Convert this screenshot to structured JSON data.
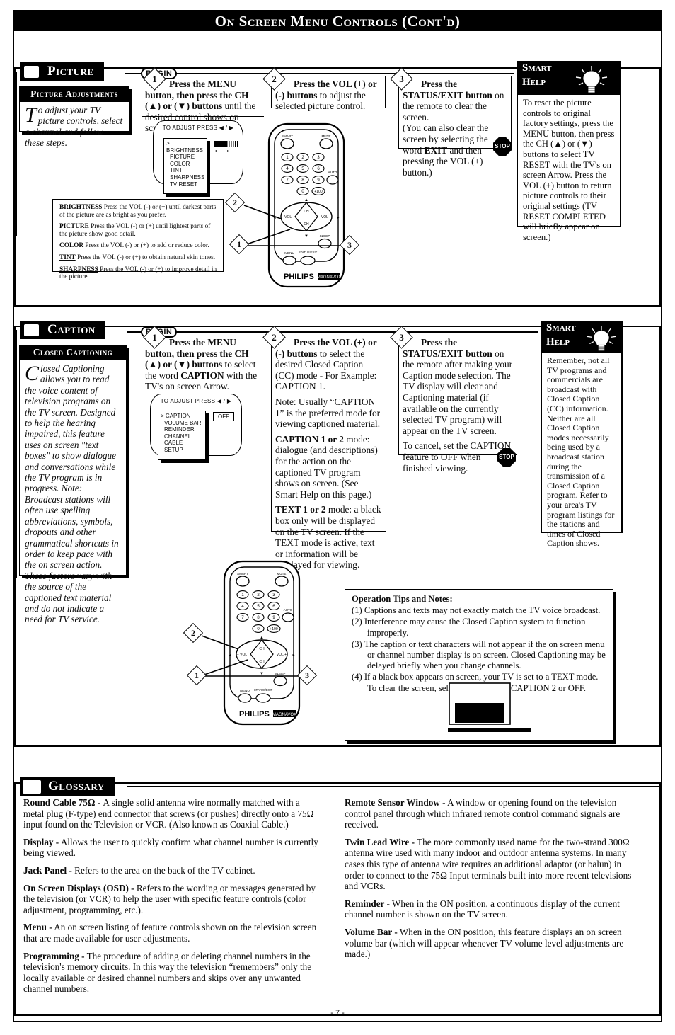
{
  "page": {
    "title": "On Screen Menu Controls (Cont'd)",
    "page_number": "- 7 -"
  },
  "picture_section": {
    "header_label": "Picture",
    "begin_tag": "BEGIN",
    "callout": {
      "title": "Picture Adjustments",
      "dropcap": "T",
      "body": "o adjust your TV picture controls, select a channel and follow these steps."
    },
    "steps": [
      {
        "number": "1",
        "text_html": "<b>Press the MENU button, then press the CH (▲) or (▼) buttons</b> until the desired control shows on screen."
      },
      {
        "number": "2",
        "text_html": "<b>Press the VOL (+) or (-) buttons</b> to adjust the selected picture control."
      },
      {
        "number": "3",
        "text_html": "<b>Press the STATUS/EXIT button</b> on the remote to clear the screen.<br>(You can also clear the screen by selecting the word <b>EXIT</b> and then pressing the VOL (+) button.)"
      }
    ],
    "tv_menu": {
      "header": "TO ADJUST PRESS ◀ / ▶",
      "items": [
        "> BRIGHTNESS",
        "PICTURE",
        "COLOR",
        "TINT",
        "SHARPNESS",
        "TV RESET"
      ]
    },
    "controls": [
      {
        "name": "BRIGHTNESS",
        "desc": "Press the VOL (-) or (+) until darkest parts of the picture are as bright as you prefer."
      },
      {
        "name": "PICTURE",
        "desc": "Press the VOL (-) or (+) until lightest parts of the picture show good detail."
      },
      {
        "name": "COLOR",
        "desc": "Press the VOL (-) or (+) to add or reduce color."
      },
      {
        "name": "TINT",
        "desc": "Press the VOL (-) or (+) to obtain natural skin tones."
      },
      {
        "name": "SHARPNESS",
        "desc": "Press the VOL (-) or (+) to improve detail in the picture."
      }
    ],
    "smart_help": {
      "line1": "Smart",
      "line2": "Help",
      "body": "To reset the picture controls to original factory settings, press the MENU button, then press the CH (▲) or (▼) buttons to select TV RESET with the TV's on screen Arrow. Press the VOL (+) button to return picture controls to their original settings (TV RESET COMPLETED will briefly appear on screen.)"
    },
    "stop_label": "STOP"
  },
  "caption_section": {
    "header_label": "Caption",
    "begin_tag": "BEGIN",
    "callout": {
      "title": "Closed Captioning",
      "dropcap": "C",
      "body": "losed Captioning allows you to read the voice content of television programs on the TV screen. Designed to help the hearing impaired, this feature uses on screen \"text boxes\" to show dialogue and conversations while the TV program is in progress.",
      "body2": "Note: Broadcast stations will often use spelling abbreviations, symbols, dropouts and other grammatical shortcuts in order to keep pace with the on screen action. These factors vary with the source of the captioned text material and do not indicate a need for TV service."
    },
    "steps": [
      {
        "number": "1",
        "text_html": "<b>Press the MENU button, then press the CH (▲) or (▼) buttons</b> to select the word <b>CAPTION</b> with the TV's on screen Arrow."
      },
      {
        "number": "2",
        "text_html": "<b>Press the VOL (+) or (-) buttons</b> to select the desired Closed Caption (CC) mode - For Example: CAPTION 1."
      },
      {
        "number": "3",
        "text_html": "<b>Press the STATUS/EXIT button</b> on the remote after making your Caption mode selection. The TV display will clear and Captioning material (if available on the currently selected TV program) will appear on the TV screen."
      }
    ],
    "step2_extra": [
      "Note: <u>Usually</u> “CAPTION 1” is the preferred mode for viewing captioned material.",
      "<b>CAPTION 1 or 2</b> mode: dialogue (and descriptions) for the action on the captioned TV program shows on screen. (See Smart Help on this page.)",
      "<b>TEXT 1 or 2</b> mode: a black box only will be displayed on the TV screen. If the TEXT mode is active, text or information will be displayed for viewing."
    ],
    "step3_extra": "To cancel, set the CAPTION feature to OFF when finished viewing.",
    "tv_menu": {
      "header": "TO ADJUST PRESS ◀ / ▶",
      "items": [
        "> CAPTION",
        "VOLUME BAR",
        "REMINDER",
        "CHANNEL",
        "CABLE",
        "SETUP"
      ],
      "value": "OFF"
    },
    "smart_help": {
      "line1": "Smart",
      "line2": "Help",
      "body": "Remember, not all TV programs and commercials are broadcast with Closed Caption (CC) information. Neither are all Closed Caption modes necessarily being used by a broadcast station during the transmission of a Closed Caption program. Refer to your area's TV program listings for the stations and times of Closed Caption shows."
    },
    "stop_label": "STOP",
    "tips": {
      "title": "Operation Tips and Notes:",
      "items": [
        "(1) Captions and texts may not exactly match the TV voice broadcast.",
        "(2) Interference may cause the Closed Caption system to function improperly.",
        "(3) The caption or text characters will not appear if the on screen menu or channel number display is on screen. Closed Captioning may be delayed briefly when you change channels.",
        "(4) If a black box appears on screen, your TV is set to a TEXT mode. To clear the screen, select CAPTION 1, CAPTION 2 or OFF."
      ]
    }
  },
  "glossary_section": {
    "header_label": "Glossary",
    "left_column": [
      {
        "term": "Round Cable 75Ω -",
        "definition": " A single solid antenna wire normally matched with a metal plug (F-type) end connector that screws (or pushes) directly onto a 75Ω input found on the Television or VCR. (Also known as Coaxial Cable.)"
      },
      {
        "term": "Display -",
        "definition": " Allows the user to quickly confirm what channel number is currently being viewed."
      },
      {
        "term": "Jack Panel -",
        "definition": " Refers to the area on the back of the TV cabinet."
      },
      {
        "term": "On Screen Displays (OSD) -",
        "definition": " Refers to the wording or messages generated by the television (or VCR) to help the user with specific feature controls (color adjustment, programming, etc.)."
      },
      {
        "term": "Menu -",
        "definition": " An on screen listing of feature controls shown on the television screen that are made available for user adjustments."
      },
      {
        "term": "Programming -",
        "definition": " The procedure of adding or deleting channel numbers in the television's memory circuits. In this way the television “remembers” only the locally available or desired channel numbers and skips over any unwanted channel numbers."
      }
    ],
    "right_column": [
      {
        "term": "Remote Sensor Window -",
        "definition": " A window or opening found on the television control panel through which infrared remote control command signals are received."
      },
      {
        "term": "Twin Lead Wire -",
        "definition": " The more commonly used name for the two-strand 300Ω antenna wire used with many indoor and outdoor antenna systems. In many cases this type of antenna wire requires an additional adaptor (or balun) in order to connect to the 75Ω Input terminals built into more recent televisions and VCRs."
      },
      {
        "term": "Reminder -",
        "definition": "  When in the ON position, a continuous display of the current channel number is shown on the TV screen."
      },
      {
        "term": "Volume Bar -",
        "definition": "  When in the ON position, this feature displays an on screen volume bar (which will appear whenever TV volume level adjustments are made.)"
      }
    ]
  },
  "remote": {
    "brand": "PHILIPS",
    "sub_brand": "MAGNAVOX",
    "top_left_button": "SMART\nSOUND",
    "top_right_button": "MUTE",
    "keys": [
      "1",
      "2",
      "3",
      "4",
      "5",
      "6",
      "7",
      "8",
      "9",
      "0",
      "+100"
    ],
    "auto_button": "AUTO",
    "ch_up": "CH",
    "ch_down": "CH",
    "vol_down": "− VOL",
    "vol_up": "VOL +",
    "sleep_button": "SLEEP",
    "menu_button": "MENU",
    "status_button": "STATUS/EXIT"
  }
}
